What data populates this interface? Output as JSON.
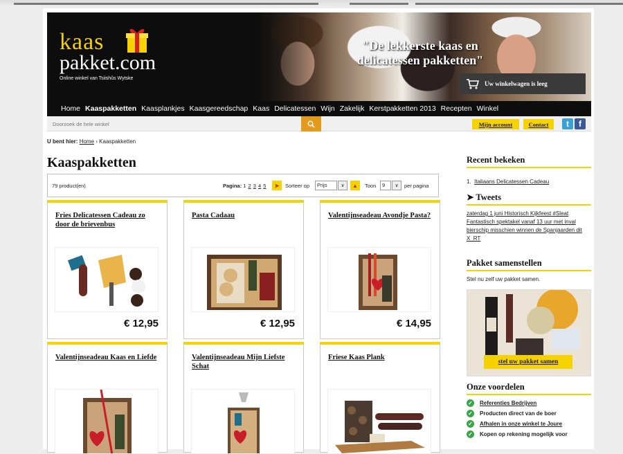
{
  "header": {
    "logo_kaas": "kaas",
    "logo_pakket": "pakket.com",
    "tagline": "Online winkel van Tsiishûs Wytske",
    "slogan": "\"De lekkerste kaas en delicatessen pakketten\"",
    "cart_label": "Uw winkelwagen is leeg"
  },
  "nav": [
    "Home",
    "Kaaspakketten",
    "Kaasplankjes",
    "Kaasgereedschap",
    "Kaas",
    "Delicatessen",
    "Wijn",
    "Zakelijk",
    "Kerstpakketten 2013",
    "Recepten",
    "Winkel"
  ],
  "search": {
    "placeholder": "Doorzoek de hele winkel"
  },
  "account": {
    "my_account": "Mijn account",
    "contact": "Contact"
  },
  "breadcrumb": {
    "prefix": "U bent hier:",
    "home": "Home",
    "sep": "›",
    "current": "Kaaspakketten"
  },
  "main": {
    "title": "Kaaspakketten"
  },
  "toolbar": {
    "count": "79 product(en)",
    "page_label": "Pagina:",
    "pages": [
      "1",
      "2",
      "3",
      "4",
      "5"
    ],
    "sort_label": "Sorteer op",
    "sort_value": "Prijs",
    "show_label": "Toon",
    "show_value": "9",
    "per_page": "per pagina"
  },
  "products": [
    {
      "name": "Fries Delicatessen Cadeau zo door de brievenbus",
      "price": "€ 12,95"
    },
    {
      "name": "Pasta Cadaau",
      "price": "€ 12,95"
    },
    {
      "name": "Valentijnseadeau Avondje Pasta?",
      "price": "€ 14,95"
    },
    {
      "name": "Valentijnseadeau Kaas en Liefde",
      "price": ""
    },
    {
      "name": "Valentijnseadeau Mijn Liefste Schat",
      "price": ""
    },
    {
      "name": "Friese Kaas Plank",
      "price": ""
    }
  ],
  "sidebar": {
    "recent_title": "Recent bekeken",
    "recent_item": "Italiaans Delicatessen Cadeau",
    "tweets_title": "Tweets",
    "tweet_text": "zaterdag 1 juni Historisch Kijkfeest #Sleat Fantastisch spektakel vanaf 13 uur met inval bierschip misschien winnen de Spanjaarden dit X_RT",
    "builder_title": "Pakket samenstellen",
    "builder_text": "Stel nu zelf uw pakket samen.",
    "builder_cta": "stel uw pakket samen",
    "benefits_title": "Onze voordelen",
    "benefits": [
      "Referenties Bedrijven",
      "Producten direct van de boer",
      "Afhalen in onze winkel te Joure",
      "Kopen op rekening mogelijk voor"
    ]
  },
  "colors": {
    "accent": "#f5d200",
    "dark": "#0d0d0d",
    "search_button": "#e49a1d",
    "check": "#3aa54a"
  }
}
